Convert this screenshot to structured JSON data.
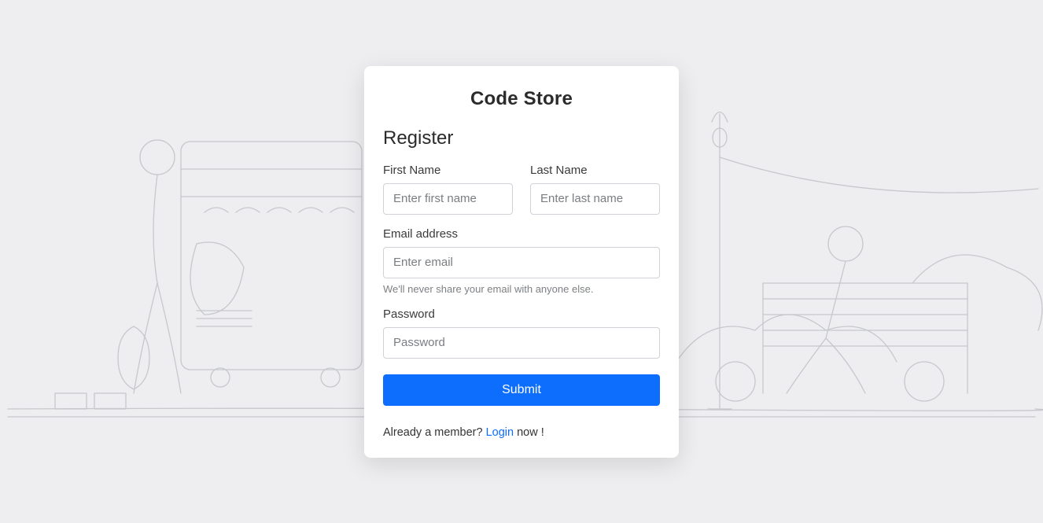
{
  "brand": "Code Store",
  "heading": "Register",
  "fields": {
    "first_name": {
      "label": "First Name",
      "placeholder": "Enter first name",
      "value": ""
    },
    "last_name": {
      "label": "Last Name",
      "placeholder": "Enter last name",
      "value": ""
    },
    "email": {
      "label": "Email address",
      "placeholder": "Enter email",
      "value": "",
      "hint": "We'll never share your email with anyone else."
    },
    "password": {
      "label": "Password",
      "placeholder": "Password",
      "value": ""
    }
  },
  "submit_label": "Submit",
  "footer": {
    "prefix": "Already a member? ",
    "link_text": "Login",
    "suffix": " now !"
  }
}
